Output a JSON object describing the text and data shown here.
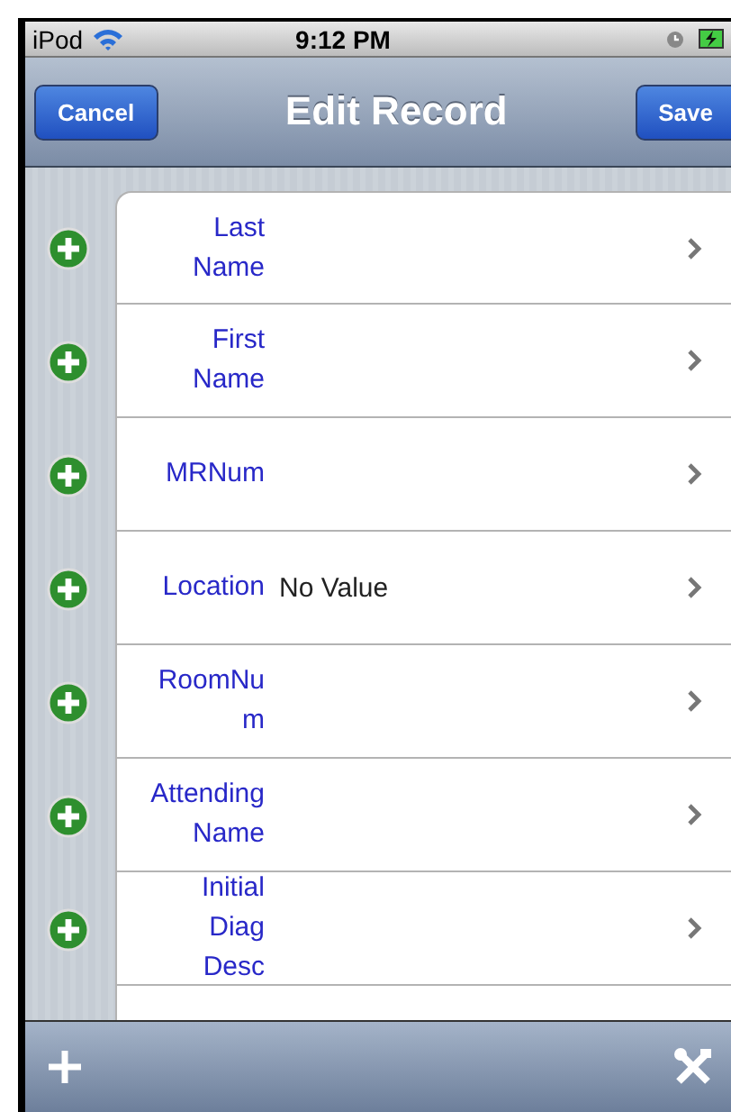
{
  "status_bar": {
    "device": "iPod",
    "time": "9:12 PM"
  },
  "nav_bar": {
    "title": "Edit Record",
    "left_button": "Cancel",
    "right_button": "Save"
  },
  "fields": [
    {
      "label": "Last\nName"
    },
    {
      "label": "First\nName"
    },
    {
      "label": "MRNum"
    },
    {
      "label": "Location",
      "value": "No Value"
    },
    {
      "label": "RoomNu\nm"
    },
    {
      "label": "Attending\nName"
    },
    {
      "label": "Initial\nDiag\nDesc"
    }
  ]
}
